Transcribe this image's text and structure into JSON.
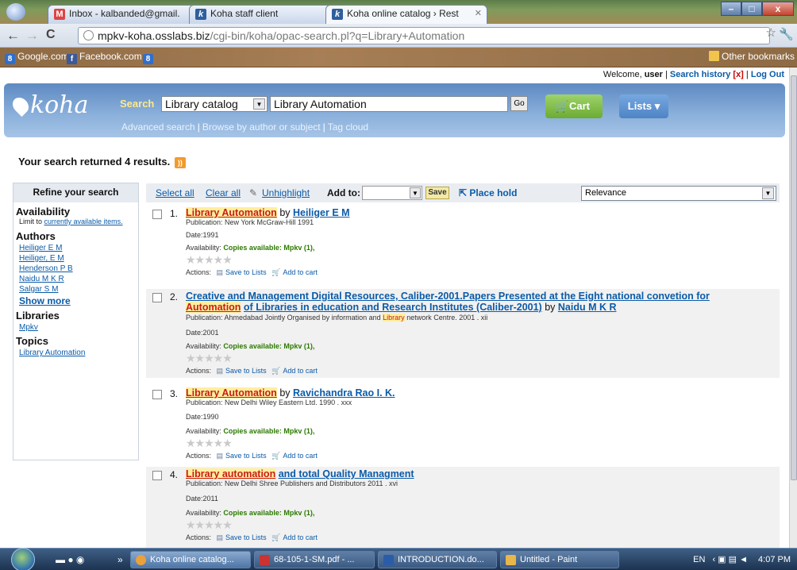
{
  "browser": {
    "tabs": [
      {
        "label": "Inbox - kalbanded@gmail.",
        "icon": "M"
      },
      {
        "label": "Koha staff client",
        "icon": "k"
      },
      {
        "label": "Koha online catalog › Rest",
        "icon": "k"
      }
    ],
    "url_main": "mpkv-koha.osslabs.biz",
    "url_rest": "/cgi-bin/koha/opac-search.pl?q=Library+Automation",
    "bookmarks": [
      "Google.com",
      "Facebook.com"
    ],
    "other_bookmarks": "Other bookmarks",
    "win_min": "–",
    "win_max": "□",
    "win_close": "x"
  },
  "userbar": {
    "welcome": "Welcome,",
    "user": "user",
    "sep": "|",
    "search_history": "Search history",
    "x": "[x]",
    "logout": "Log Out"
  },
  "header": {
    "logo": "koha",
    "search_label": "Search",
    "catalog_select": "Library catalog",
    "query": "Library Automation",
    "go": "Go",
    "cart": "Cart",
    "lists": "Lists ▾",
    "advanced": "Advanced search",
    "browse": "Browse by author or subject",
    "tagcloud": "Tag cloud"
  },
  "results_count": "Your search returned 4 results.",
  "refine": {
    "title": "Refine your search",
    "availability": "Availability",
    "limit_prefix": "Limit to",
    "limit_link": "currently available items.",
    "authors": "Authors",
    "author_items": [
      "Heiliger E M",
      "Heiliger, E M",
      "Henderson P B",
      "Naidu M K R",
      "Salgar S M"
    ],
    "show_more": "Show more",
    "libraries": "Libraries",
    "library_items": [
      "Mpkv"
    ],
    "topics": "Topics",
    "topic_items": [
      "Library Automation"
    ]
  },
  "toolbar": {
    "select_all": "Select all",
    "clear_all": "Clear all",
    "unhighlight": "Unhighlight",
    "add_to": "Add to:",
    "save": "Save",
    "place_hold": "Place hold",
    "sort": "Relevance"
  },
  "results": [
    {
      "num": "1.",
      "title_hl": "Library Automation",
      "title_rest": "",
      "by": "by",
      "author": "Heiliger E M",
      "publication": "Publication: New York McGraw-Hill 1991",
      "date": "Date:1991",
      "avail_label": "Availability:",
      "avail_value": "Copies available: Mpkv (1),"
    },
    {
      "num": "2.",
      "title_line1": "Creative and Management Digital Resources, Caliber-2001.Papers Presented at the Eight national convetion for",
      "title_hl": "Automation",
      "title_rest": "of Libraries in education and Research Institutes (Caliber-2001)",
      "by": "by",
      "author": "Naidu M K R",
      "publication_a": "Publication: Ahmedabad Jointly Organised by information and",
      "publication_hl": "Library",
      "publication_b": "network Centre. 2001 . xii",
      "date": "Date:2001",
      "avail_label": "Availability:",
      "avail_value": "Copies available: Mpkv (1),"
    },
    {
      "num": "3.",
      "title_hl": "Library Automation",
      "title_rest": "",
      "by": "by",
      "author": "Ravichandra Rao I. K.",
      "publication": "Publication: New Delhi Wiley Eastern Ltd. 1990 . xxx",
      "date": "Date:1990",
      "avail_label": "Availability:",
      "avail_value": "Copies available: Mpkv (1),"
    },
    {
      "num": "4.",
      "title_hl": "Library automation",
      "title_rest": "and total Quality Managment",
      "by": "",
      "author": "",
      "publication": "Publication: New Delhi Shree Publishers and Distributors 2011 . xvi",
      "date": "Date:2011",
      "avail_label": "Availability:",
      "avail_value": "Copies available: Mpkv (1),"
    }
  ],
  "actions": {
    "label": "Actions:",
    "save_to_lists": "Save to Lists",
    "add_to_cart": "Add to cart"
  },
  "taskbar": {
    "items": [
      "Koha online catalog...",
      "68-105-1-SM.pdf - ...",
      "INTRODUCTION.do...",
      "Untitled - Paint"
    ],
    "lang": "EN",
    "time": "4:07 PM",
    "more": "»"
  }
}
